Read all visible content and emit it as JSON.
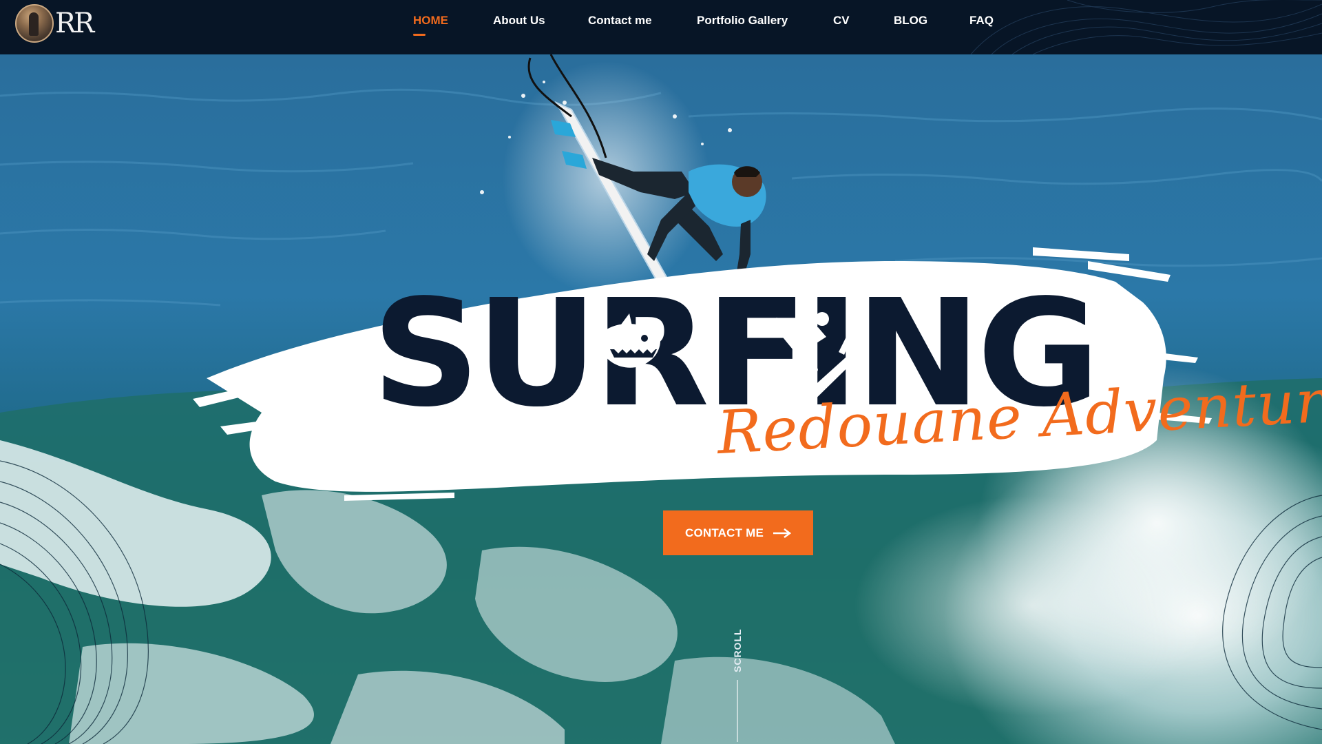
{
  "brand": {
    "logo_text": "RR",
    "logo_icon": "surfer-portrait-avatar"
  },
  "nav": {
    "items": [
      {
        "label": "HOME",
        "active": true
      },
      {
        "label": "About Us",
        "active": false
      },
      {
        "label": "Contact me",
        "active": false
      },
      {
        "label": "Portfolio Gallery",
        "active": false
      },
      {
        "label": "CV",
        "active": false
      },
      {
        "label": "BLOG",
        "active": false
      },
      {
        "label": "FAQ",
        "active": false
      }
    ]
  },
  "hero": {
    "title": "SURFING",
    "subtitle": "Redouane Adventure",
    "cta_label": "CONTACT ME",
    "cta_icon": "arrow-right-icon",
    "scroll_label": "SCROLL",
    "title_icons": [
      "shark-icon",
      "surfer-icon"
    ]
  },
  "colors": {
    "accent": "#f26b1d",
    "navbar_bg": "#071526",
    "title_color": "#0c1a30",
    "ocean_blue": "#1f6e9e",
    "ocean_green": "#1f6f6a"
  }
}
